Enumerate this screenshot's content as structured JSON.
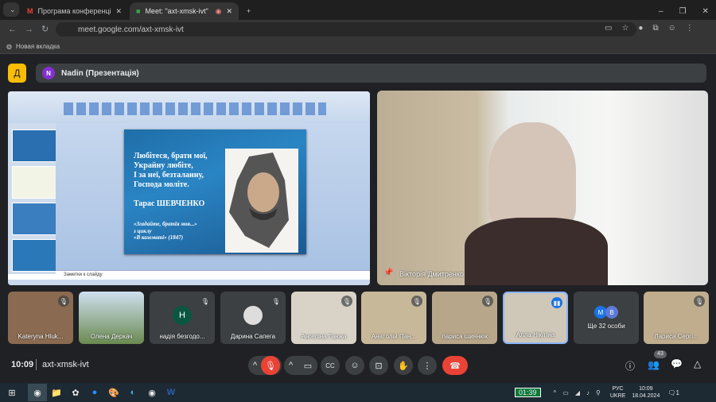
{
  "browser": {
    "tabs": [
      {
        "title": "Програма конференції \"Обр"
      },
      {
        "title": "Meet: \"axt-xmsk-ivt\""
      }
    ],
    "url": "meet.google.com/axt-xmsk-ivt",
    "bookmark": "Новая вкладка"
  },
  "meet": {
    "presenter_initial": "N",
    "presenter": "Nadin (Презентація)",
    "logo": "Д",
    "slide": {
      "poem": [
        "Любітеся, брати мої,",
        "Украйну любіте,",
        "І за неї, безталанну,",
        "Господа моліте."
      ],
      "author": "Тарас ШЕВЧЕНКО",
      "source": [
        "«Згадайте, братія моя...»",
        "з циклу",
        "«В казематі» (1847)"
      ],
      "notes": "Заметки к слайду"
    },
    "main_speaker": "Вікторія Дмитренко",
    "tiles": [
      {
        "name": "Kateryna Hluk..."
      },
      {
        "name": "Олена Деркач"
      },
      {
        "name": "надія безгодо...",
        "initial": "H"
      },
      {
        "name": "Дарина Сапега"
      },
      {
        "name": "Ангеліна Ганжа"
      },
      {
        "name": "Анатолій Пан..."
      },
      {
        "name": "лариса шиянюк"
      },
      {
        "name": "Алла Нікітіна"
      },
      {
        "name": "Ще 32 особи",
        "initials": [
          "M",
          "B"
        ]
      },
      {
        "name": "Лариса Сергі..."
      }
    ],
    "time": "10:09",
    "code": "axt-xmsk-ivt",
    "participants_count": "43"
  },
  "taskbar": {
    "timer": "01:39",
    "lang1": "РУС",
    "lang2": "UKRE",
    "time": "10:09",
    "date": "18.04.2024",
    "notif": "1"
  },
  "colors": {
    "end_call": "#ea4335",
    "accent": "#8ab4f8"
  }
}
